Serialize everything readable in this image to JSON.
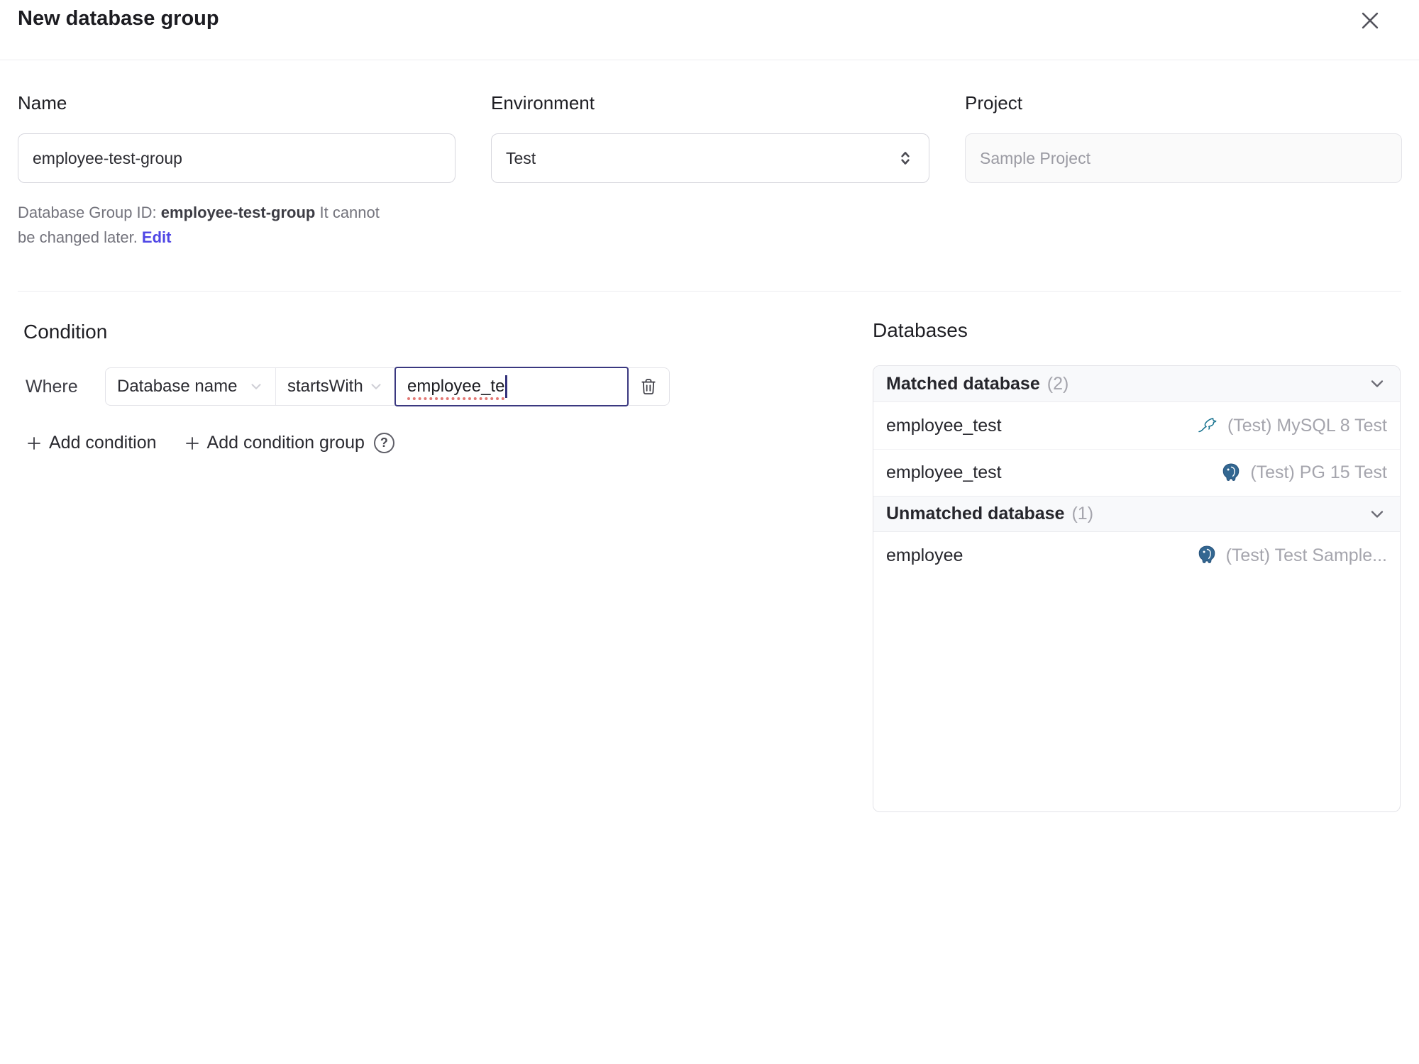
{
  "dialog": {
    "title": "New database group"
  },
  "form": {
    "name": {
      "label": "Name",
      "value": "employee-test-group"
    },
    "environment": {
      "label": "Environment",
      "value": "Test"
    },
    "project": {
      "label": "Project",
      "value": "Sample Project"
    },
    "id_hint": {
      "prefix": "Database Group ID: ",
      "id": "employee-test-group",
      "note": " It cannot be changed later. ",
      "edit": "Edit"
    }
  },
  "condition": {
    "heading": "Condition",
    "where": "Where",
    "factor": "Database name",
    "operator": "startsWith",
    "value": "employee_te",
    "add_condition": "Add condition",
    "add_condition_group": "Add condition group",
    "help": "?"
  },
  "databases": {
    "heading": "Databases",
    "sections": [
      {
        "title": "Matched database",
        "count": "(2)",
        "rows": [
          {
            "name": "employee_test",
            "engine": "mysql",
            "instance": "(Test) MySQL 8 Test"
          },
          {
            "name": "employee_test",
            "engine": "postgres",
            "instance": "(Test) PG 15 Test"
          }
        ]
      },
      {
        "title": "Unmatched database",
        "count": "(1)",
        "rows": [
          {
            "name": "employee",
            "engine": "postgres",
            "instance": "(Test) Test Sample..."
          }
        ]
      }
    ]
  },
  "colors": {
    "accent": "#4f46e5",
    "focus_border": "#3a3880",
    "mysql": "#16728f",
    "postgres": "#336791",
    "muted_text": "#a5a5ad",
    "panel_header_bg": "#f8f9fb",
    "border": "#e3e3e8"
  }
}
